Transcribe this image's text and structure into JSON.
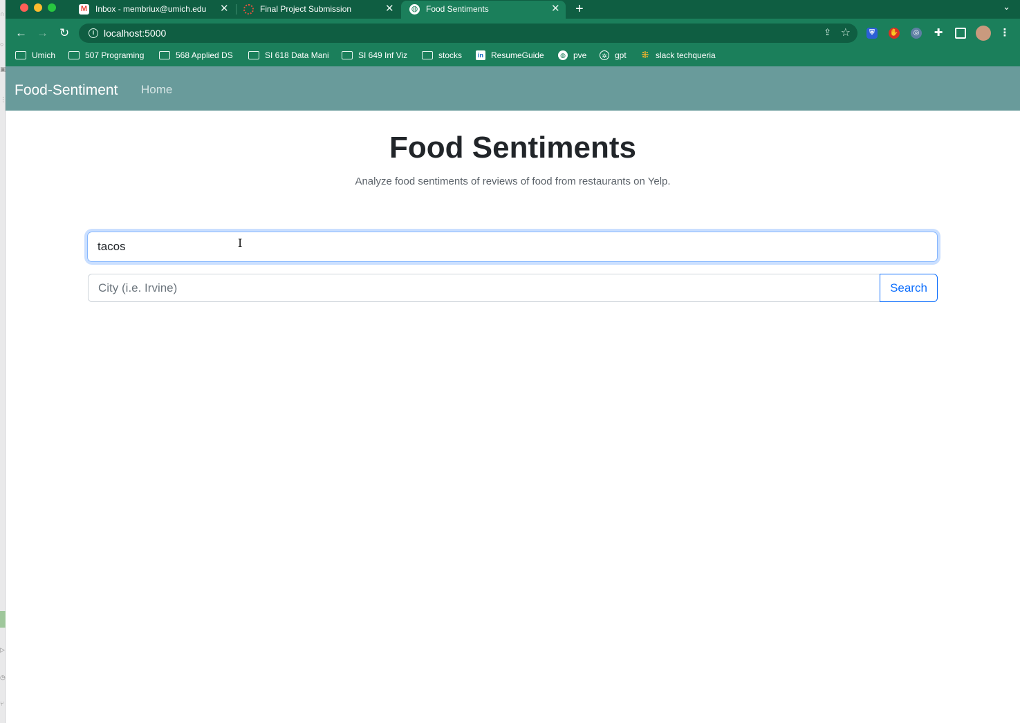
{
  "browser": {
    "tabs": [
      {
        "title": "Inbox - membriux@umich.edu",
        "favicon": "gmail-icon",
        "active": false
      },
      {
        "title": "Final Project Submission",
        "favicon": "canvas-icon",
        "active": false
      },
      {
        "title": "Food Sentiments",
        "favicon": "globe-icon",
        "active": true
      }
    ],
    "url": "localhost:5000",
    "bookmarks": [
      {
        "label": "Umich",
        "icon": "folder-icon"
      },
      {
        "label": "507 Programing",
        "icon": "folder-icon"
      },
      {
        "label": "568 Applied DS",
        "icon": "folder-icon"
      },
      {
        "label": "SI 618 Data Mani",
        "icon": "folder-icon"
      },
      {
        "label": "SI 649 Inf Viz",
        "icon": "folder-icon"
      },
      {
        "label": "stocks",
        "icon": "folder-icon"
      },
      {
        "label": "ResumeGuide",
        "icon": "linkedin-icon"
      },
      {
        "label": "pve",
        "icon": "globe-icon"
      },
      {
        "label": "gpt",
        "icon": "openai-icon"
      },
      {
        "label": "slack techqueria",
        "icon": "slack-icon"
      }
    ],
    "colors": {
      "frame": "#0f5e42",
      "toolbar": "#1b7f5b"
    }
  },
  "site": {
    "brand": "Food-Sentiment",
    "nav_home": "Home",
    "nav_color": "#699b9b"
  },
  "hero": {
    "title": "Food Sentiments",
    "subtitle": "Analyze food sentiments of reviews of food from restaurants on Yelp."
  },
  "form": {
    "food_value": "tacos ",
    "city_placeholder": "City (i.e. Irvine)",
    "search_label": "Search",
    "accent": "#0d6efd"
  }
}
